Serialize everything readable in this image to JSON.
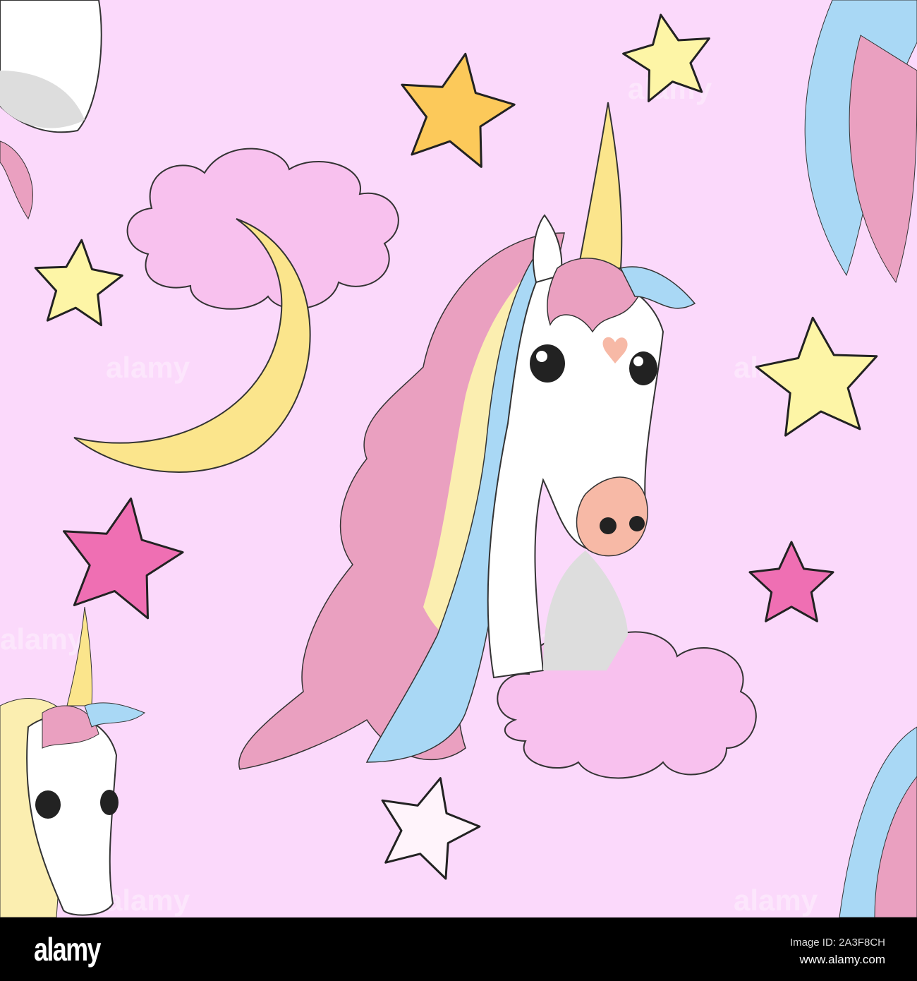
{
  "watermark": "alamy",
  "footer": {
    "logo": "alamy",
    "image_id": "Image ID: 2A3F8CH",
    "website": "www.alamy.com"
  },
  "colors": {
    "background": "#fbd9fb",
    "star_yellow": "#fdf5a6",
    "star_orange": "#fcc95a",
    "star_pink": "#ef6fb3",
    "moon": "#fbe58c",
    "cloud": "#f8c1ee",
    "mane_pink": "#eaa0c0",
    "mane_blue": "#a9d8f5",
    "mane_yellow": "#fbeeb0"
  }
}
